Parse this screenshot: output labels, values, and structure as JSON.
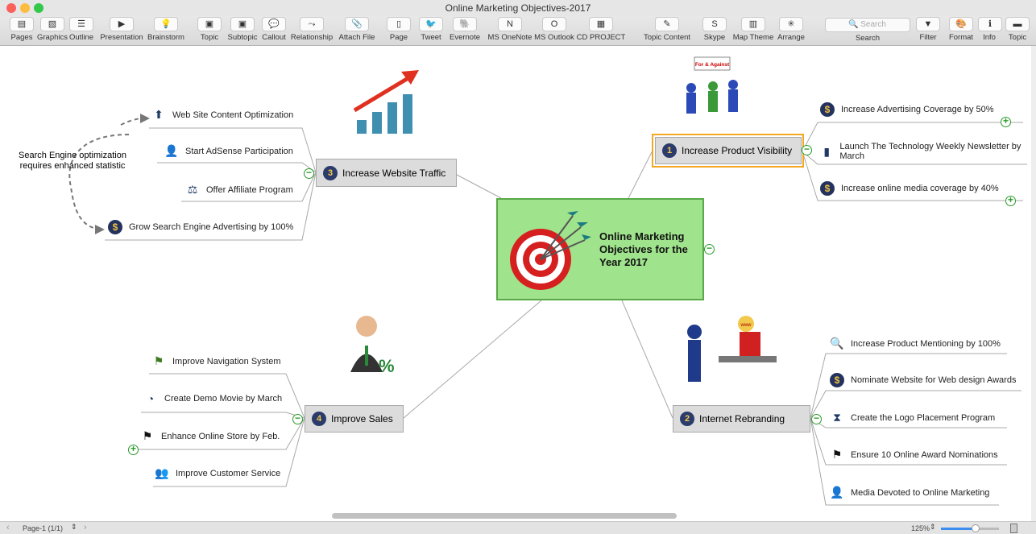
{
  "window": {
    "title": "Online Marketing Objectives-2017"
  },
  "toolbar": {
    "items": [
      {
        "label": "Pages",
        "icon": "pages-icon"
      },
      {
        "label": "Graphics",
        "icon": "graphics-icon"
      },
      {
        "label": "Outline",
        "icon": "outline-icon"
      },
      {
        "label": "Presentation",
        "icon": "presentation-icon"
      },
      {
        "label": "Brainstorm",
        "icon": "brainstorm-icon"
      },
      {
        "label": "Topic",
        "icon": "topic-icon"
      },
      {
        "label": "Subtopic",
        "icon": "subtopic-icon"
      },
      {
        "label": "Callout",
        "icon": "callout-icon"
      },
      {
        "label": "Relationship",
        "icon": "relationship-icon"
      },
      {
        "label": "Attach File",
        "icon": "paperclip-icon"
      },
      {
        "label": "Page",
        "icon": "page-icon"
      },
      {
        "label": "Tweet",
        "icon": "twitter-icon"
      },
      {
        "label": "Evernote",
        "icon": "evernote-icon"
      },
      {
        "label": "MS OneNote",
        "icon": "onenote-icon"
      },
      {
        "label": "MS Outlook",
        "icon": "outlook-icon"
      },
      {
        "label": "CD PROJECT",
        "icon": "cd-project-icon"
      },
      {
        "label": "Topic Content",
        "icon": "topic-content-icon"
      },
      {
        "label": "Skype",
        "icon": "skype-icon"
      },
      {
        "label": "Map Theme",
        "icon": "map-theme-icon"
      },
      {
        "label": "Arrange",
        "icon": "arrange-icon"
      },
      {
        "label": "Filter",
        "icon": "filter-icon"
      },
      {
        "label": "Format",
        "icon": "format-icon"
      },
      {
        "label": "Info",
        "icon": "info-icon"
      },
      {
        "label": "Topic",
        "icon": "topic-panel-icon"
      }
    ],
    "search": {
      "placeholder": "Search",
      "label": "Search"
    }
  },
  "map": {
    "central": "Online Marketing Objectives for the Year 2017",
    "callout": "Search Engine optimization requires enhanced statistic",
    "topics": [
      {
        "num": "1",
        "label": "Increase Product Visibility",
        "subtopics": [
          "Increase Advertising Coverage by 50%",
          "Launch The Technology Weekly Newsletter by March",
          "Increase online media coverage by 40%"
        ]
      },
      {
        "num": "2",
        "label": "Internet Rebranding",
        "subtopics": [
          "Increase Product Mentioning by 100%",
          "Nominate Website for Web design Awards",
          "Create the Logo Placement Program",
          "Ensure 10 Online Award Nominations",
          "Media Devoted to Online Marketing"
        ]
      },
      {
        "num": "3",
        "label": "Increase Website Traffic",
        "subtopics": [
          "Web Site Content Optimization",
          "Start AdSense Participation",
          "Offer Affiliate Program",
          "Grow Search Engine Advertising by 100%"
        ]
      },
      {
        "num": "4",
        "label": "Improve  Sales",
        "subtopics": [
          "Improve Navigation System",
          "Create Demo Movie by March",
          "Enhance Online Store by Feb.",
          "Improve Customer Service"
        ]
      }
    ],
    "clipart_label": "For & Against",
    "www_label": "www"
  },
  "status": {
    "page": "Page-1 (1/1)",
    "zoom": "125%",
    "zoom_slider_percent": 60
  },
  "colors": {
    "central_fill": "#9fe38c",
    "topic_fill": "#dcdcdc",
    "selected_outline": "#f5a623",
    "toggle": "#2a9a2a"
  }
}
